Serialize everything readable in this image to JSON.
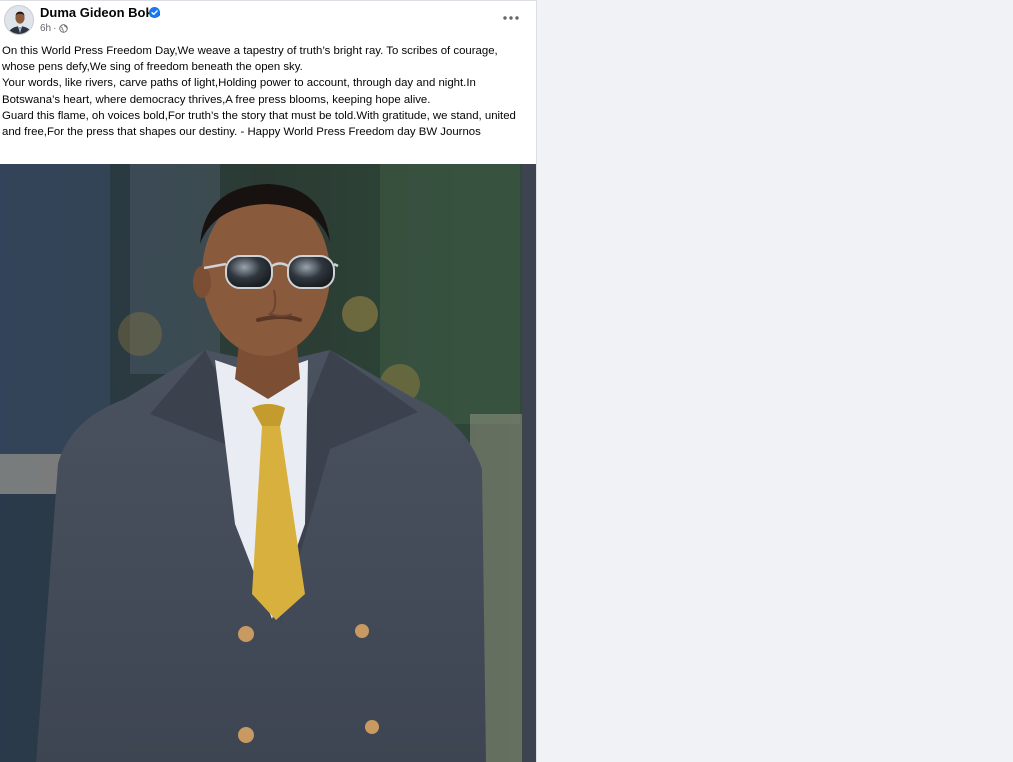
{
  "post": {
    "author": "Duma Gideon Boko",
    "verified": true,
    "time": "6h",
    "separator": "·",
    "audience_icon": "globe-icon",
    "more_icon": "more-options-icon",
    "paragraphs": [
      "On this World Press Freedom Day,We weave a tapestry of truth’s bright ray. To scribes of courage, whose pens defy,We sing of freedom beneath the open sky.",
      "Your words, like rivers, carve paths of light,Holding power to account, through day and night.In Botswana’s heart, where democracy thrives,A free press blooms, keeping hope alive.",
      "Guard this flame, oh voices bold,For truth’s the story that must be told.With gratitude, we stand, united and free,For the press that shapes our destiny. - Happy World Press Freedom day BW Journos"
    ]
  },
  "colors": {
    "verified_badge": "#1877f2",
    "secondary_text": "#65676b",
    "page_background": "#f0f2f5"
  }
}
